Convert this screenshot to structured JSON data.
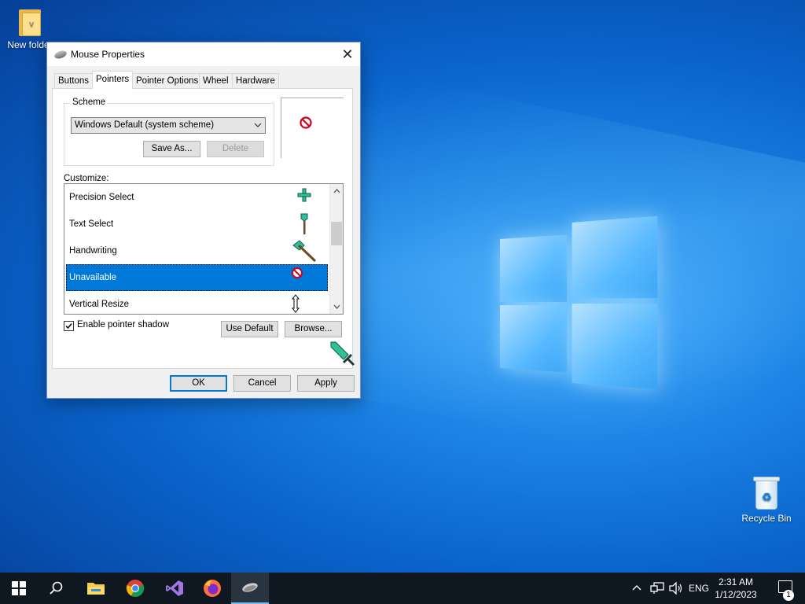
{
  "desktop": {
    "folder_label": "New folder",
    "recycle_bin_label": "Recycle Bin"
  },
  "dialog": {
    "title": "Mouse Properties",
    "close_glyph": "✕",
    "tabs": [
      "Buttons",
      "Pointers",
      "Pointer Options",
      "Wheel",
      "Hardware"
    ],
    "active_tab": "Pointers",
    "scheme": {
      "group_label": "Scheme",
      "selected": "Windows Default (system scheme)",
      "save_as_label": "Save As...",
      "delete_label": "Delete"
    },
    "customize_label": "Customize:",
    "cursor_list": [
      {
        "label": "Precision Select",
        "icon": "crosshair-icon"
      },
      {
        "label": "Text Select",
        "icon": "shovel-icon"
      },
      {
        "label": "Handwriting",
        "icon": "axe-icon"
      },
      {
        "label": "Unavailable",
        "icon": "no-sign-icon",
        "selected": true
      },
      {
        "label": "Vertical Resize",
        "icon": "vertical-resize-icon"
      }
    ],
    "enable_shadow_label": "Enable pointer shadow",
    "enable_shadow_checked": true,
    "use_default_label": "Use Default",
    "browse_label": "Browse...",
    "ok_label": "OK",
    "cancel_label": "Cancel",
    "apply_label": "Apply"
  },
  "taskbar": {
    "apps": [
      "start-icon",
      "search-icon",
      "file-explorer-icon",
      "chrome-icon",
      "visual-studio-icon",
      "firefox-icon",
      "mouse-properties-icon"
    ],
    "language": "ENG",
    "time": "2:31 AM",
    "date": "1/12/2023",
    "notification_count": "1"
  },
  "colors": {
    "selection": "#0078d7",
    "taskbar": "#0f1720",
    "cursor_teal": "#2fbf9a"
  }
}
